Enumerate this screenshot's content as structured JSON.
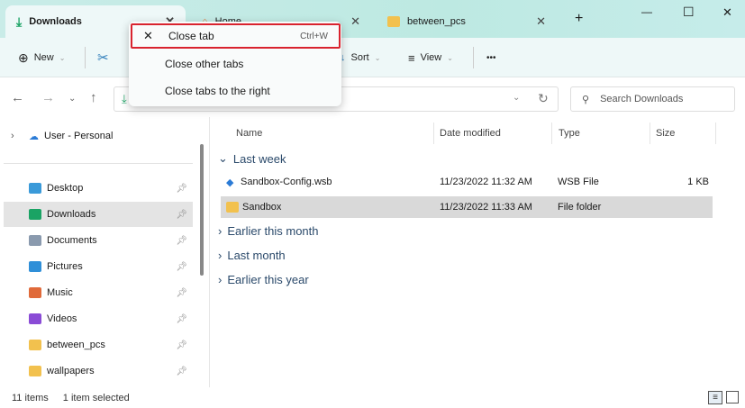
{
  "tabs": [
    {
      "label": "Downloads"
    },
    {
      "label": "Home"
    },
    {
      "label": "between_pcs"
    }
  ],
  "window_controls": {
    "new_tab": "+",
    "minimize": "—",
    "maximize": "☐",
    "close": "✕"
  },
  "toolbar": {
    "new": "New",
    "sort": "Sort",
    "view": "View",
    "more": "•••"
  },
  "search": {
    "placeholder": "Search Downloads"
  },
  "context_menu": {
    "items": [
      {
        "label": "Close tab",
        "shortcut": "Ctrl+W"
      },
      {
        "label": "Close other tabs"
      },
      {
        "label": "Close tabs to the right"
      }
    ]
  },
  "sidebar": {
    "cloud": "User - Personal",
    "items": [
      {
        "label": "Desktop",
        "color": "#3a9ad9"
      },
      {
        "label": "Downloads",
        "color": "#1aa364"
      },
      {
        "label": "Documents",
        "color": "#8a9aae"
      },
      {
        "label": "Pictures",
        "color": "#2f8fd8"
      },
      {
        "label": "Music",
        "color": "#e06a3a"
      },
      {
        "label": "Videos",
        "color": "#8a4bd6"
      },
      {
        "label": "between_pcs",
        "color": "#f2c14e"
      },
      {
        "label": "wallpapers",
        "color": "#f2c14e"
      }
    ]
  },
  "columns": {
    "name": "Name",
    "date": "Date modified",
    "type": "Type",
    "size": "Size"
  },
  "groups": {
    "last_week": "Last week",
    "earlier_month": "Earlier this month",
    "last_month": "Last month",
    "earlier_year": "Earlier this year"
  },
  "files": [
    {
      "name": "Sandbox-Config.wsb",
      "date": "11/23/2022 11:32 AM",
      "type": "WSB File",
      "size": "1 KB"
    },
    {
      "name": "Sandbox",
      "date": "11/23/2022 11:33 AM",
      "type": "File folder",
      "size": ""
    }
  ],
  "status": {
    "count": "11 items",
    "selected": "1 item selected"
  }
}
